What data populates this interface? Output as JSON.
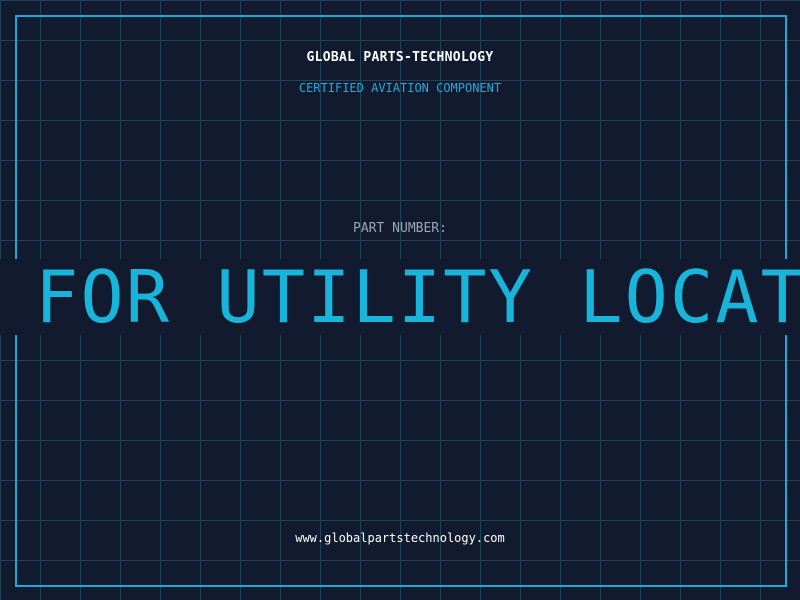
{
  "header": {
    "brand": "GLOBAL PARTS-TECHNOLOGY",
    "subtitle": "CERTIFIED AVIATION COMPONENT"
  },
  "part": {
    "label": "PART NUMBER:",
    "value": "FOR UTILITY LOCAT"
  },
  "footer": {
    "website": "www.globalpartstechnology.com"
  },
  "colors": {
    "background": "#111a2e",
    "grid": "#1f4457",
    "accent": "#1ba9d6",
    "part_text": "#18b4d9",
    "label_text": "#9aa7b8",
    "heading_text": "#ffffff"
  }
}
